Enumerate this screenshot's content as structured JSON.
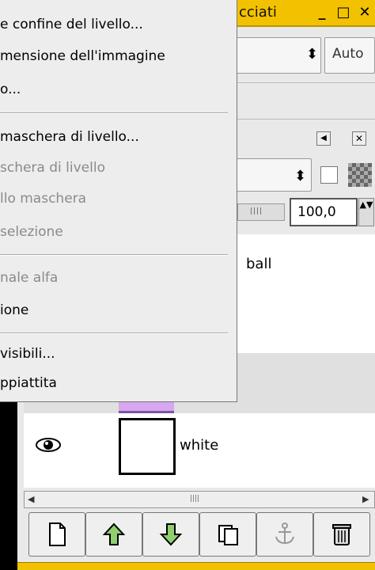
{
  "window": {
    "title": "cciati",
    "minimize_glyph": "_",
    "maximize_glyph": "□",
    "close_glyph": "✕"
  },
  "toolbar": {
    "zoom_label": "Auto",
    "combo_arrow": "⬍",
    "mode_arrow": "⬍",
    "opacity_value": "100,0",
    "opacity_spin": "▲▼",
    "slider_grip": "||||",
    "panel_left_glyph": "◀",
    "panel_close_glyph": "✕"
  },
  "layers": [
    {
      "name": "ball",
      "visible": false
    },
    {
      "name": "white",
      "visible": true
    }
  ],
  "scroll": {
    "left": "◀",
    "right": "▶",
    "grip": "||||"
  },
  "bottom_buttons": [
    {
      "icon": "new-layer-icon"
    },
    {
      "icon": "raise-layer-icon"
    },
    {
      "icon": "lower-layer-icon"
    },
    {
      "icon": "duplicate-layer-icon"
    },
    {
      "icon": "anchor-layer-icon"
    },
    {
      "icon": "delete-layer-icon"
    }
  ],
  "menu": {
    "items": [
      {
        "label": "e confine del livello...",
        "disabled": false
      },
      {
        "label": "mensione dell'immagine",
        "disabled": false
      },
      {
        "label": "o...",
        "disabled": false
      },
      {
        "label": "maschera di livello...",
        "disabled": false
      },
      {
        "label": "schera di livello",
        "disabled": true
      },
      {
        "label": "llo maschera",
        "disabled": true
      },
      {
        "label": "selezione",
        "disabled": true
      },
      {
        "label": "nale alfa",
        "disabled": true
      },
      {
        "label": "ione",
        "disabled": false
      },
      {
        "label": "visibili...",
        "disabled": false
      },
      {
        "label": "ppiattita",
        "disabled": false
      }
    ]
  }
}
